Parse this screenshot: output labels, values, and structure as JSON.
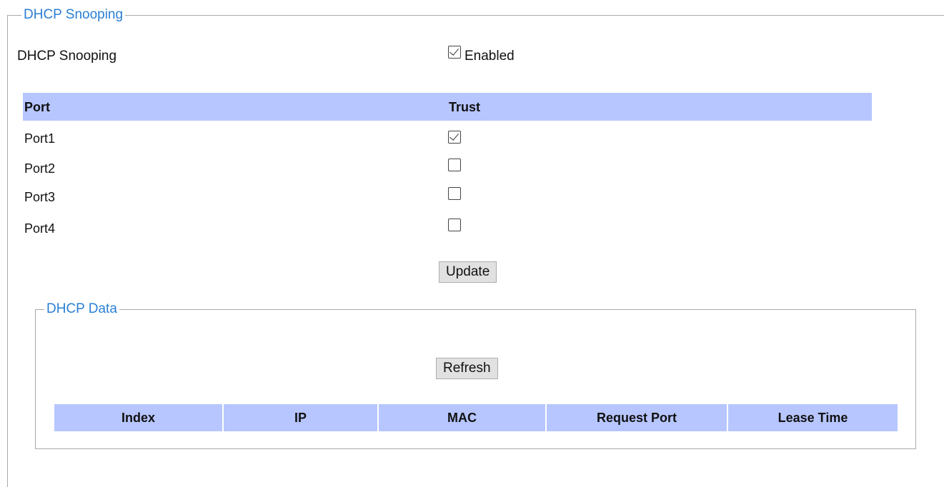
{
  "section": {
    "legend": "DHCP Snooping",
    "snooping_label": "DHCP Snooping",
    "snooping_enabled": true,
    "snooping_enabled_label": "Enabled"
  },
  "ports_table": {
    "headers": {
      "port": "Port",
      "trust": "Trust"
    },
    "rows": [
      {
        "port": "Port1",
        "trust": true
      },
      {
        "port": "Port2",
        "trust": false
      },
      {
        "port": "Port3",
        "trust": false
      },
      {
        "port": "Port4",
        "trust": false
      }
    ]
  },
  "update_button": "Update",
  "dhcp_data": {
    "legend": "DHCP Data",
    "refresh_button": "Refresh",
    "columns": [
      "Index",
      "IP",
      "MAC",
      "Request Port",
      "Lease Time"
    ]
  }
}
